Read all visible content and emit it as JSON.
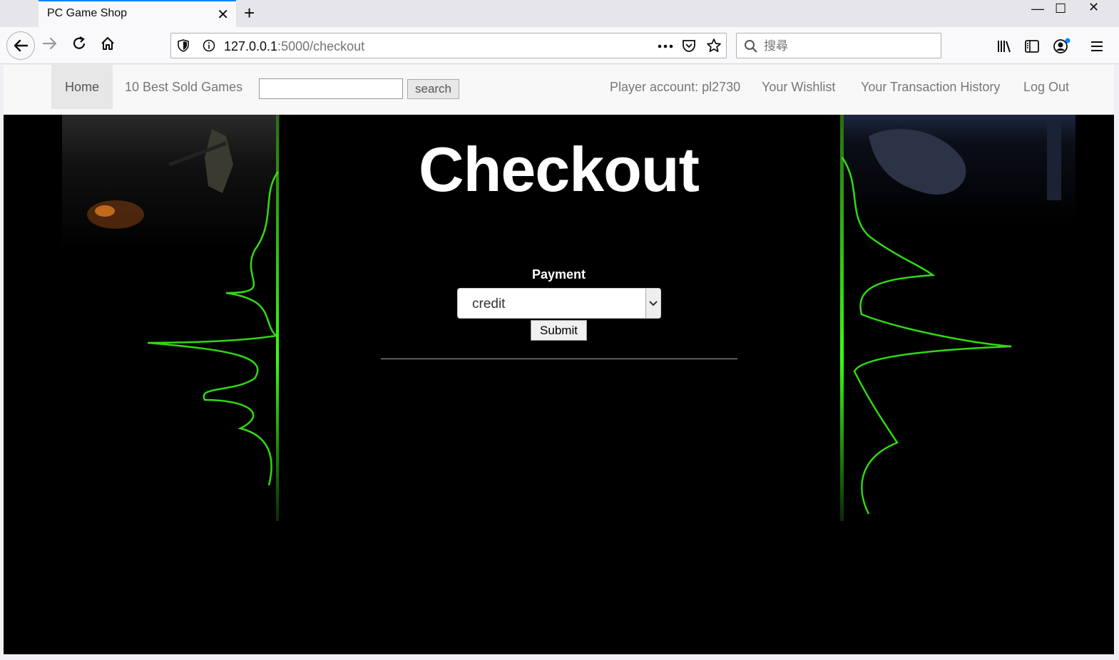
{
  "browser": {
    "tab_title": "PC Game Shop",
    "tab_close": "✕",
    "new_tab": "+",
    "window": {
      "minimize": "—",
      "maximize": "☐",
      "close": "✕"
    },
    "url_host": "127.0.0.1",
    "url_path": ":5000/checkout",
    "search_placeholder": "搜尋",
    "icons": [
      "back-arrow-icon",
      "forward-arrow-icon",
      "reload-icon",
      "home-icon",
      "shield-icon",
      "info-icon",
      "more-icon",
      "pocket-icon",
      "star-icon",
      "search-icon",
      "library-icon",
      "sidebar-icon",
      "account-icon",
      "menu-icon"
    ]
  },
  "site_nav": {
    "home": "Home",
    "best_sold": "10 Best Sold Games",
    "search_button": "search",
    "player_account": "Player account: pl2730",
    "wishlist": "Your Wishlist",
    "transactions": "Your Transaction History",
    "logout": "Log Out"
  },
  "main": {
    "heading": "Checkout",
    "payment_label": "Payment",
    "payment_selected": "credit",
    "submit_label": "Submit"
  },
  "colors": {
    "accent": "#0a84ff",
    "glow": "#39ff14",
    "page_bg": "#000000"
  }
}
